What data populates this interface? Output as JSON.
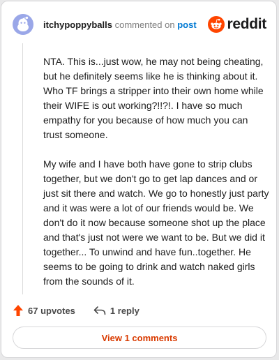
{
  "header": {
    "username": "itchypoppyballs",
    "commented_text": "commented on",
    "post_link": "post",
    "brand": "reddit"
  },
  "comment": {
    "paragraphs": [
      "NTA. This is...just wow, he may not being cheating, but he definitely seems like he is thinking about it. Who TF brings a stripper into their own home while their WIFE is out working?!!?!. I have so much empathy for you because of how much you can trust someone.",
      "My wife and I have both have gone to strip clubs together, but we don't go to get lap dances and or just sit there and watch. We go to honestly just party and it was were a lot of our friends would be. We don't do it now because someone shot up the place and that's just not were we want to be. But we did it together... To unwind and have fun..together. He seems to be going to drink and watch naked girls from the sounds of it."
    ]
  },
  "actions": {
    "upvotes_label": "67 upvotes",
    "reply_label": "1 reply",
    "view_comments_label": "View 1 comments"
  },
  "icons": {
    "avatar": "reddit-snoo-avatar-icon",
    "brand_logo": "reddit-logo-icon",
    "upvote": "upvote-arrow-icon",
    "reply": "reply-arrow-icon"
  },
  "colors": {
    "brand_orange": "#ff4500",
    "link_blue": "#0079d3",
    "view_comments_text": "#d93a00",
    "upvote_arrow": "#ff4500",
    "avatar_bg": "#9aa7e8"
  }
}
